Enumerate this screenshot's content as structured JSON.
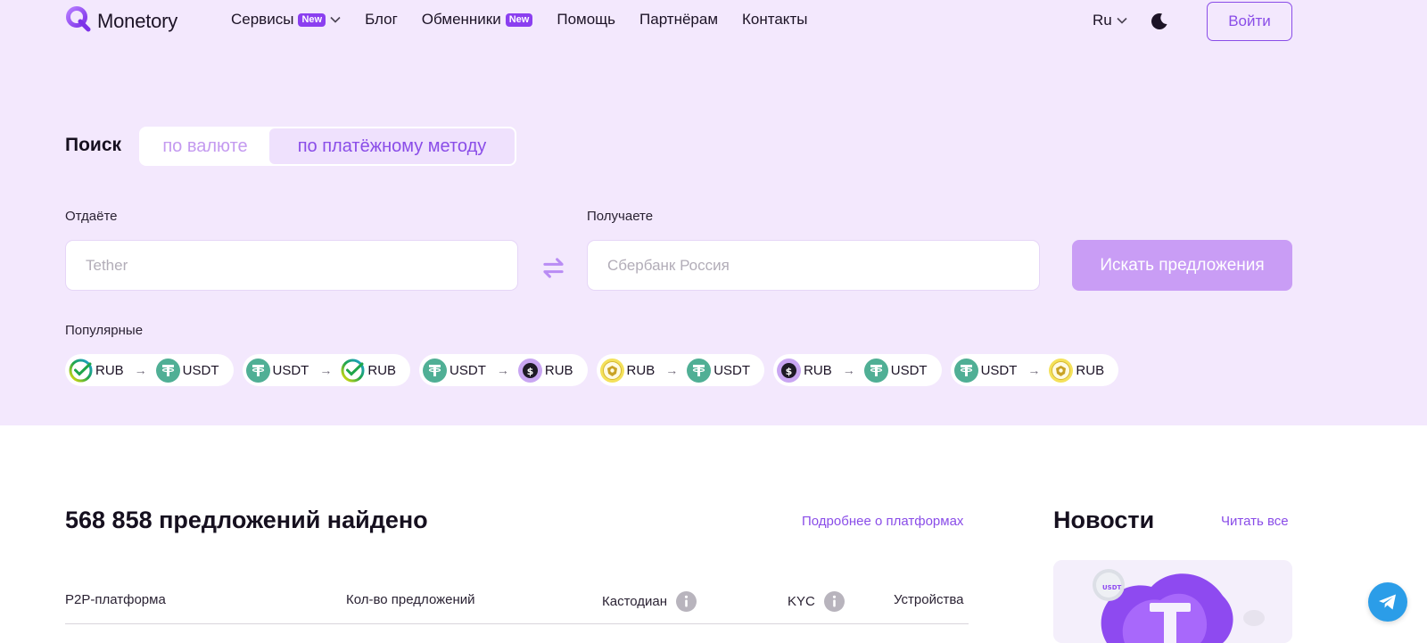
{
  "header": {
    "logo_text": "Monetory",
    "nav": [
      {
        "label": "Сервисы",
        "badge": "New",
        "has_dropdown": true
      },
      {
        "label": "Блог"
      },
      {
        "label": "Обменники",
        "badge": "New"
      },
      {
        "label": "Помощь"
      },
      {
        "label": "Партнёрам"
      },
      {
        "label": "Контакты"
      }
    ],
    "language": "Ru",
    "login_label": "Войти",
    "icons": {
      "logo": "monetory-logo-icon",
      "theme": "moon-icon",
      "dropdown": "chevron-down-icon"
    }
  },
  "search": {
    "label": "Поиск",
    "mode_options": [
      "по валюте",
      "по платёжному методу"
    ],
    "active_mode": "по платёжному методу",
    "give_label": "Отдаёте",
    "give_placeholder": "Tether",
    "receive_label": "Получаете",
    "receive_placeholder": "Сбербанк Россия",
    "button_label": "Искать предложения",
    "swap_icon": "swap-arrows-icon"
  },
  "popular": {
    "label": "Популярные",
    "pairs": [
      {
        "from": "RUB",
        "from_icon": "sber-icon",
        "to": "USDT",
        "to_icon": "tether-icon"
      },
      {
        "from": "USDT",
        "from_icon": "tether-icon",
        "to": "RUB",
        "to_icon": "sber-icon"
      },
      {
        "from": "USDT",
        "from_icon": "tether-icon",
        "to": "RUB",
        "to_icon": "dollar-coin-icon"
      },
      {
        "from": "RUB",
        "from_icon": "bank-crest-icon",
        "to": "USDT",
        "to_icon": "tether-icon"
      },
      {
        "from": "RUB",
        "from_icon": "dollar-coin-icon",
        "to": "USDT",
        "to_icon": "tether-icon"
      },
      {
        "from": "USDT",
        "from_icon": "tether-icon",
        "to": "RUB",
        "to_icon": "bank-crest-icon"
      }
    ],
    "arrow": "→"
  },
  "results": {
    "title": "568 858 предложений найдено",
    "more_link": "Подробнее о платформах",
    "columns": [
      "P2P-платформа",
      "Кол-во предложений",
      "Кастодиан",
      "KYC",
      "Устройства"
    ]
  },
  "news": {
    "title": "Новости",
    "read_all": "Читать все",
    "card_badge": "USDT"
  },
  "colors": {
    "accent": "#8a4de8",
    "hero_bg": "#f3e8fd",
    "badge": "#8b3ff0",
    "button_disabled": "#c99df5",
    "tether": "#50af95",
    "telegram": "#2b9de8"
  }
}
